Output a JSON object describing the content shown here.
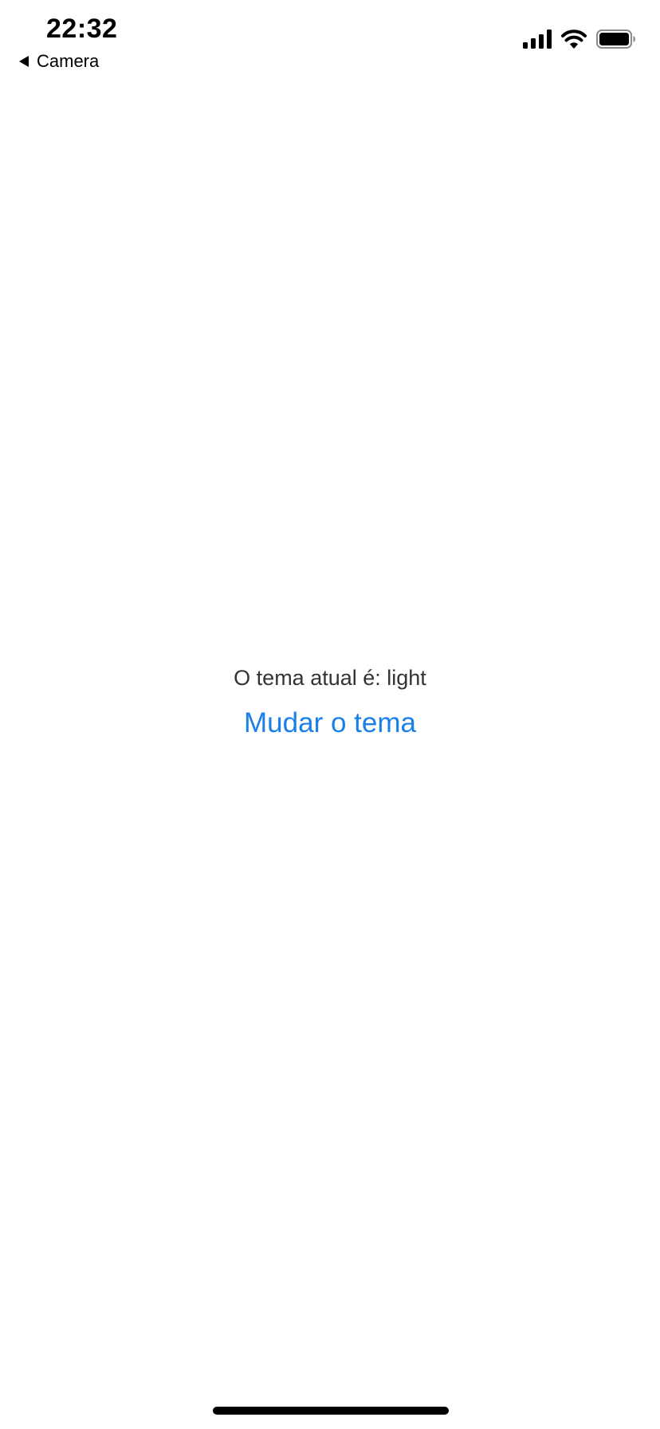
{
  "status_bar": {
    "time": "22:32",
    "back_label": "Camera",
    "icons": [
      "signal-icon",
      "wifi-icon",
      "battery-icon"
    ]
  },
  "main": {
    "theme_label": "O tema atual é: light",
    "toggle_button_label": "Mudar o tema"
  },
  "colors": {
    "background": "#ffffff",
    "text": "#333333",
    "accent": "#1a7fe8",
    "status_text": "#000000"
  }
}
